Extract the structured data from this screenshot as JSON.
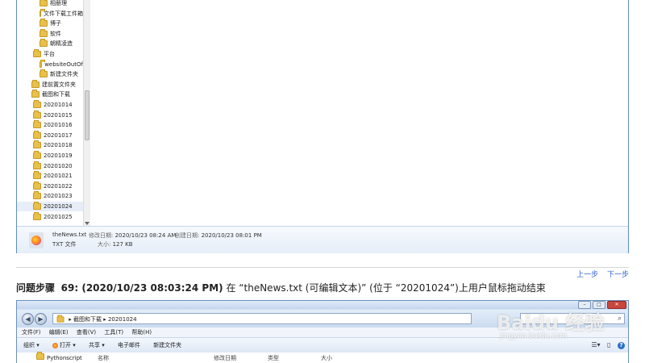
{
  "explorer_top": {
    "tree_items": [
      {
        "label": "相册理",
        "indent": 2
      },
      {
        "label": "文件下载工件箱",
        "indent": 2
      },
      {
        "label": "博子",
        "indent": 2
      },
      {
        "label": "软件",
        "indent": 2
      },
      {
        "label": "朝精凌造",
        "indent": 2
      },
      {
        "label": "平台",
        "indent": 1
      },
      {
        "label": "websiteOutOf",
        "indent": 2
      },
      {
        "label": "新建文件夹",
        "indent": 2
      },
      {
        "label": "建前置文件夹",
        "indent": 0
      },
      {
        "label": "截图和下载",
        "indent": 0
      },
      {
        "label": "20201014",
        "indent": 1
      },
      {
        "label": "20201015",
        "indent": 1
      },
      {
        "label": "20201016",
        "indent": 1
      },
      {
        "label": "20201017",
        "indent": 1
      },
      {
        "label": "20201018",
        "indent": 1
      },
      {
        "label": "20201019",
        "indent": 1
      },
      {
        "label": "20201020",
        "indent": 1
      },
      {
        "label": "20201021",
        "indent": 1
      },
      {
        "label": "20201022",
        "indent": 1
      },
      {
        "label": "20201023",
        "indent": 1
      },
      {
        "label": "20201024",
        "indent": 1,
        "selected": true
      },
      {
        "label": "20201025",
        "indent": 1
      }
    ],
    "details": {
      "filename": "theNews.txt",
      "modified_label": "修改日期:",
      "modified_value": "2020/10/23 08:24 AM",
      "created_label": "创建日期:",
      "created_value": "2020/10/23 08:01 PM",
      "type": "TXT 文件",
      "size_label": "大小:",
      "size_value": "127 KB"
    }
  },
  "nav": {
    "prev": "上一步",
    "next": "下一步"
  },
  "step": {
    "prefix": "问题步骤",
    "number_time": "69: (2020/10/23 08:03:24 PM)",
    "text": "在 “theNews.txt (可编辑文本)” (位于 “20201024”)上用户鼠标拖动结束"
  },
  "explorer_bottom": {
    "breadcrumb": [
      "截图和下载",
      "20201024"
    ],
    "menu": [
      "文件(F)",
      "编辑(E)",
      "查看(V)",
      "工具(T)",
      "帮助(H)"
    ],
    "toolbar": [
      "组织 ▾",
      "打开 ▾",
      "共享 ▾",
      "电子邮件",
      "新建文件夹"
    ],
    "tree_item": "Pythonscript",
    "columns": [
      "名称",
      "修改日期",
      "类型",
      "大小"
    ]
  },
  "watermark": {
    "brand": "Baidu 经验",
    "url": "jingyan.baidu.com"
  },
  "colors": {
    "window_border": "#5b8fc7",
    "link": "#3366cc",
    "folder": "#e8c04a"
  }
}
